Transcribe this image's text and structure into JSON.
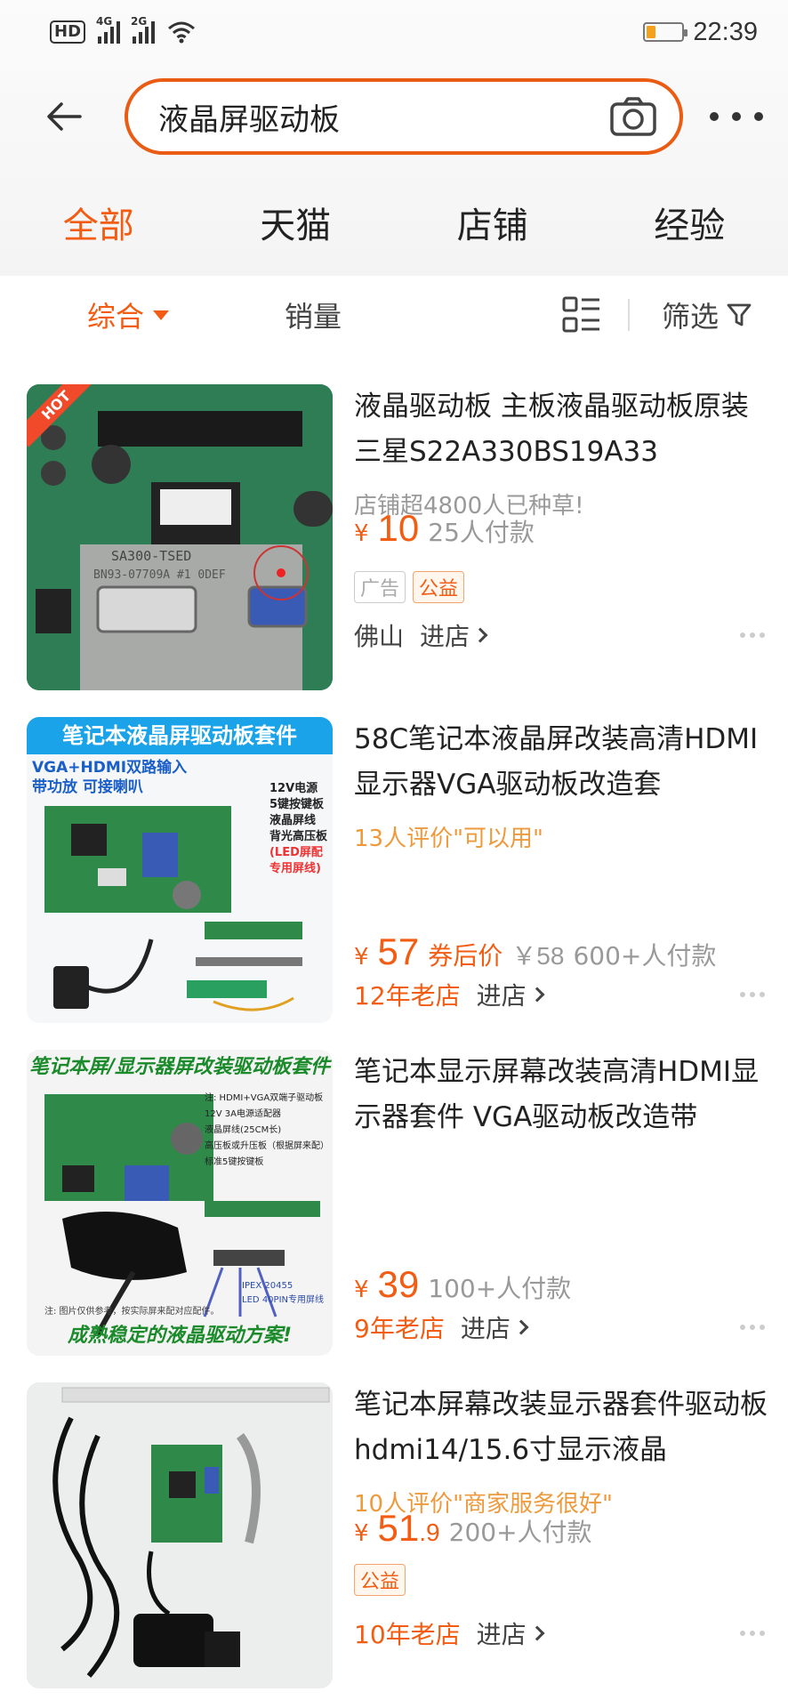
{
  "status_bar": {
    "hd": "HD",
    "sim1_type": "4G",
    "sim2_type": "2G",
    "time": "22:39",
    "battery_level": 0.25
  },
  "search": {
    "query": "液晶屏驱动板",
    "back_icon": "back-arrow-icon",
    "camera_icon": "camera-icon",
    "more_icon": "more-dots-icon"
  },
  "top_tabs": [
    {
      "label": "全部",
      "active": true
    },
    {
      "label": "天猫",
      "active": false
    },
    {
      "label": "店铺",
      "active": false
    },
    {
      "label": "经验",
      "active": false
    }
  ],
  "filters": {
    "sort_label": "综合",
    "sales_label": "销量",
    "filter_label": "筛选"
  },
  "colors": {
    "accent": "#f25d13",
    "secondary": "#ee9a3c",
    "muted": "#999999"
  },
  "products": [
    {
      "title": "液晶驱动板 主板液晶驱动板原装三星S22A330BS19A33",
      "subtitle": "店铺超4800人已种草!",
      "price_yen": "¥",
      "price": "10",
      "paid": "25人付款",
      "tags": [
        "广告",
        "公益"
      ],
      "shop": "佛山",
      "enter": "进店",
      "image_text": {
        "hot": "HOT",
        "chip": "SA300-TSED",
        "code": "BN93-07709A #1 0DEF"
      }
    },
    {
      "title": "58C笔记本液晶屏改装高清HDMI显示器VGA驱动板改造套",
      "subtitle": "13人评价\"可以用\"",
      "price_yen": "¥",
      "price": "57",
      "coupon": "券后价",
      "orig_price": "￥58",
      "paid": "600+人付款",
      "shop_badge": "12年老店",
      "enter": "进店",
      "image_text": {
        "banner": "笔记本液晶屏驱动板套件",
        "sub1": "VGA+HDMI双路输入",
        "sub2": "带功放 可接喇叭",
        "spec1": "12V电源",
        "spec2": "5键按键板",
        "spec3": "液晶屏线",
        "spec4": "背光高压板",
        "spec5": "(LED屏配",
        "spec6": "专用屏线)"
      }
    },
    {
      "title": "笔记本显示屏幕改装高清HDMI显示器套件 VGA驱动板改造带",
      "price_yen": "¥",
      "price": "39",
      "paid": "100+人付款",
      "shop_badge": "9年老店",
      "enter": "进店",
      "image_text": {
        "banner": "笔记本屏/显示器屏改装驱动板套件",
        "bottom": "成熟稳定的液晶驱动方案!",
        "spec1": "注: HDMI+VGA双端子驱动板",
        "spec2": "12V 3A电源适配器",
        "spec3": "液晶屏线(25CM长)",
        "spec4": "高压板或升压板（根据屏来配）",
        "spec5": "标准5键按键板",
        "ipex1": "IPEX 20455",
        "ipex2": "LED 40PIN专用屏线",
        "note": "注: 图片仅供参考，按实际屏来配对应配件。"
      }
    },
    {
      "title": "笔记本屏幕改装显示器套件驱动板hdmi14/15.6寸显示液晶",
      "subtitle": "10人评价\"商家服务很好\"",
      "price_yen": "¥",
      "price": "51",
      "price_dec": ".9",
      "paid": "200+人付款",
      "tags": [
        "公益"
      ],
      "shop_badge": "10年老店",
      "enter": "进店"
    }
  ]
}
